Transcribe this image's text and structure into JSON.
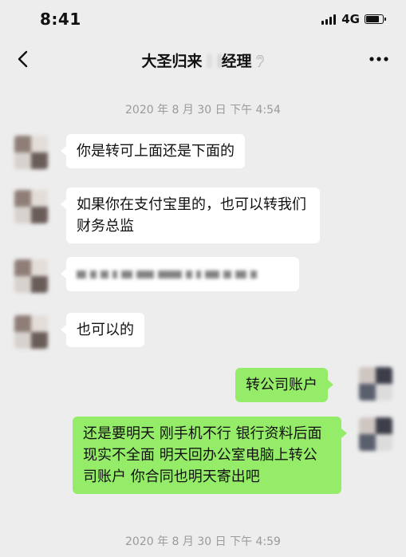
{
  "status_bar": {
    "time": "8:41",
    "network": "4G",
    "signal_icon": "signal-bars-icon",
    "battery_icon": "battery-icon",
    "battery_level": 0.8
  },
  "nav": {
    "title_prefix": "大圣归来",
    "title_suffix": "经理",
    "back_icon": "chevron-left-icon",
    "more_icon": "more-dots-icon",
    "ear_icon": "ear-icon"
  },
  "timestamps": [
    "2020 年 8 月 30 日  下午 4:54",
    "2020 年 8 月 30 日  下午 4:59"
  ],
  "messages": [
    {
      "side": "left",
      "text": "你是转可上面还是下面的"
    },
    {
      "side": "left",
      "text": "如果你在支付宝里的，也可以转我们财务总监"
    },
    {
      "side": "left",
      "text": "",
      "redacted": true
    },
    {
      "side": "left",
      "text": "也可以的"
    },
    {
      "side": "right",
      "text": "转公司账户"
    },
    {
      "side": "right",
      "text": "还是要明天 刚手机不行 银行资料后面现实不全面 明天回办公室电脑上转公司账户 你合同也明天寄出吧"
    }
  ],
  "colors": {
    "background": "#ededed",
    "bubble_right": "#95ec69",
    "bubble_left": "#ffffff",
    "timestamp": "#9a9a9a"
  }
}
